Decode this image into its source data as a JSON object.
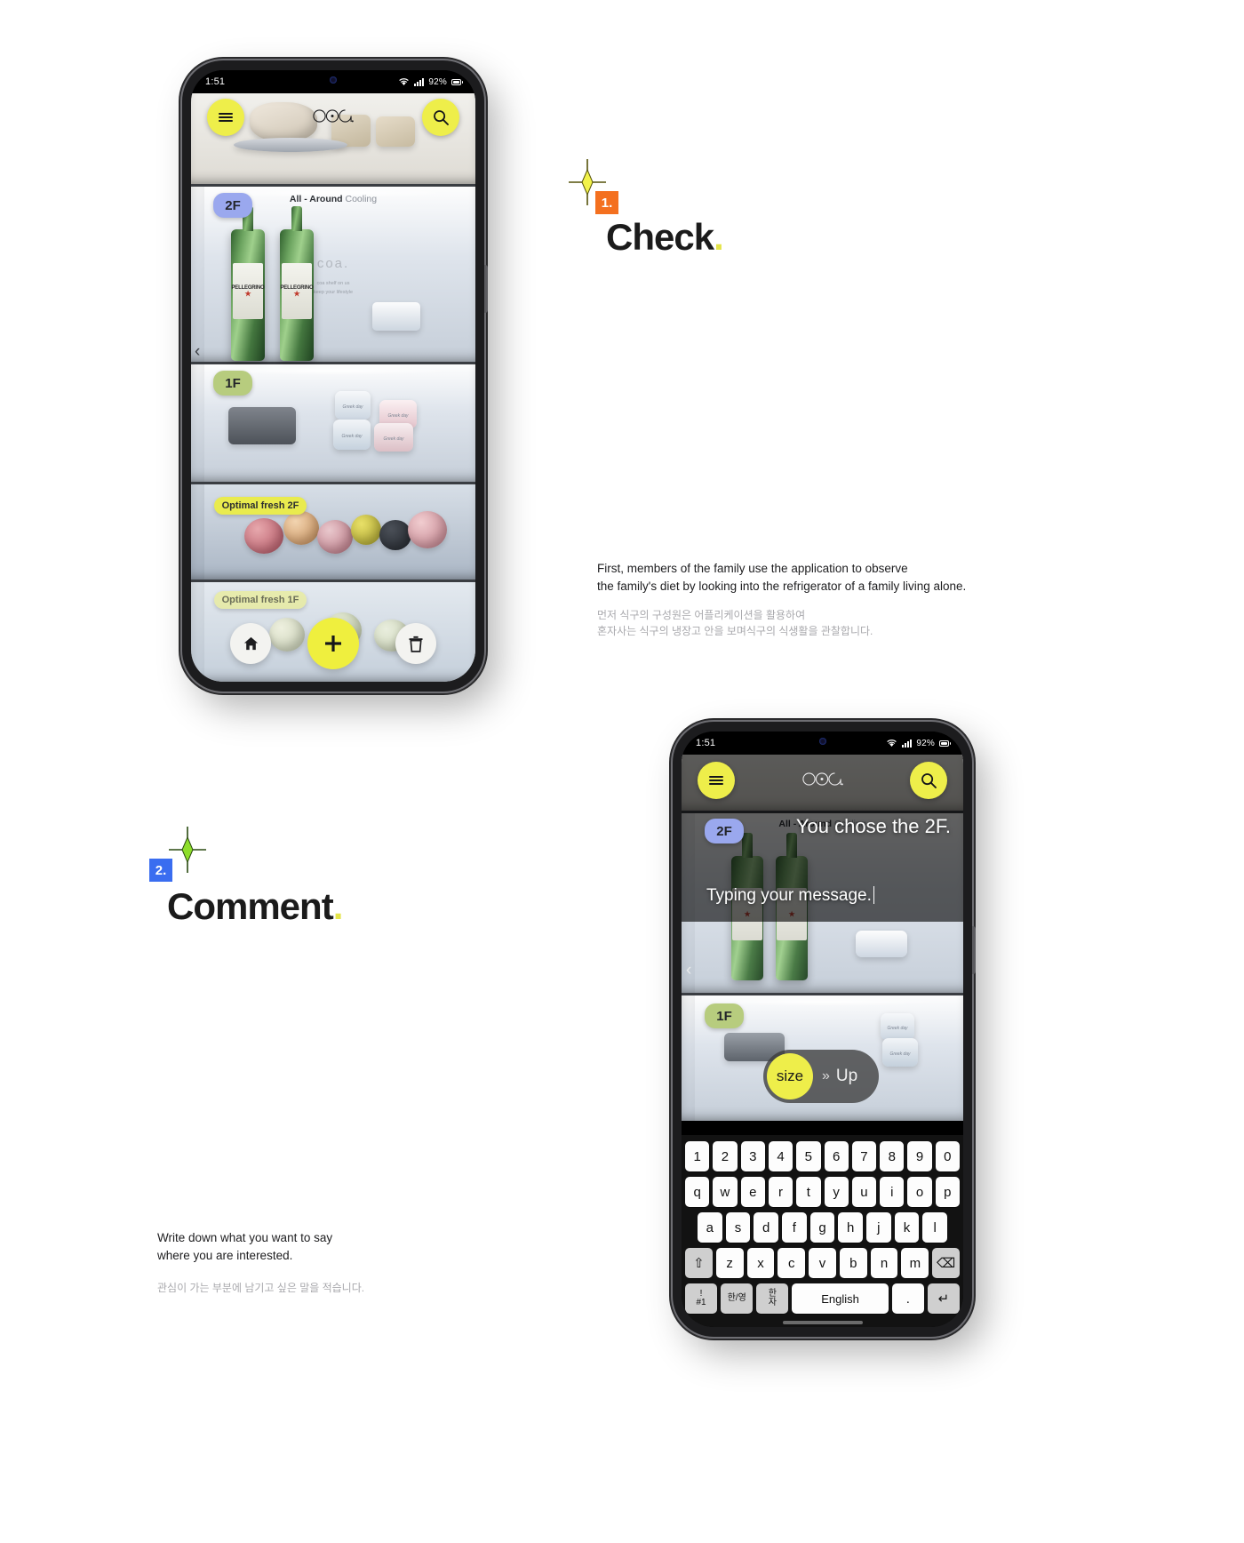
{
  "page": {
    "background": "#ffffff",
    "accent_yellow": "#eeee4a",
    "accent_orange": "#f4701f",
    "accent_blue": "#3a6df0",
    "floor2_color": "#9aa8ee",
    "floor1_color": "#b7cc7e"
  },
  "steps": [
    {
      "number": "1.",
      "title": "Check",
      "title_dot": ".",
      "badge_color": "#f4701f",
      "sparkle_color": "#f2f24a",
      "paragraph_en": "First, members of the family use the application to observe\nthe family's diet by looking into the refrigerator of a family living alone.",
      "paragraph_ko": "먼저 식구의 구성원은 어플리케이션을 활용하여\n혼자사는 식구의 냉장고 안을 보며식구의 식생활을 관찰합니다."
    },
    {
      "number": "2.",
      "title": "Comment",
      "title_dot": ".",
      "badge_color": "#3a6df0",
      "sparkle_color": "#8ede2a",
      "paragraph_en": "Write down what you want to say\nwhere you are interested.",
      "paragraph_ko": "관심이 가는 부분에 남기고 싶은 말을 적습니다."
    }
  ],
  "phone1": {
    "statusbar": {
      "time": "1:51",
      "battery_percent": "92%",
      "wifi_icon": "wifi-icon",
      "signal_icon": "signal-icon",
      "battery_icon": "battery-icon"
    },
    "topbar": {
      "menu_icon": "hamburger-menu-icon",
      "logo": "coa.",
      "search_icon": "search-icon"
    },
    "cooling_label_bold": "All - Around",
    "cooling_label_light": "Cooling",
    "watermark": "coa.",
    "watermark_sub_1": "coa shelf on us",
    "watermark_sub_2": "keep your lifestyle",
    "floors": [
      {
        "label": "2F"
      },
      {
        "label": "1F"
      }
    ],
    "drawers": [
      {
        "label": "Optimal fresh 2F",
        "style": "solid"
      },
      {
        "label": "Optimal fresh 1F",
        "style": "ghost"
      }
    ],
    "prev_arrow": "‹",
    "bottles": [
      {
        "brand": "PELLEGRINO"
      },
      {
        "brand": "PELLEGRINO"
      }
    ],
    "tubs": [
      {
        "label": "Greek day"
      },
      {
        "label": "Greek day"
      },
      {
        "label": "Greek day"
      },
      {
        "label": "Greek day"
      }
    ],
    "bottom_nav": [
      {
        "icon": "home-icon",
        "name": "home-button"
      },
      {
        "icon": "plus-icon",
        "name": "add-button"
      },
      {
        "icon": "trash-icon",
        "name": "delete-button"
      }
    ]
  },
  "phone2": {
    "statusbar": {
      "time": "1:51",
      "battery_percent": "92%",
      "wifi_icon": "wifi-icon",
      "signal_icon": "signal-icon",
      "battery_icon": "battery-icon"
    },
    "topbar": {
      "menu_icon": "hamburger-menu-icon",
      "logo": "coa.",
      "search_icon": "search-icon"
    },
    "headline": "You chose the 2F.",
    "message_placeholder": "Typing your message.",
    "cooling_label_bold": "All - Around",
    "cooling_label_light": "Cooling",
    "floors": [
      {
        "label": "2F"
      },
      {
        "label": "1F"
      }
    ],
    "size_control": {
      "chip": "size",
      "arrows": "»",
      "value": "Up"
    },
    "prev_arrow": "‹",
    "keyboard": {
      "row1": [
        "1",
        "2",
        "3",
        "4",
        "5",
        "6",
        "7",
        "8",
        "9",
        "0"
      ],
      "row2": [
        "q",
        "w",
        "e",
        "r",
        "t",
        "y",
        "u",
        "i",
        "o",
        "p"
      ],
      "row3": [
        "a",
        "s",
        "d",
        "f",
        "g",
        "h",
        "j",
        "k",
        "l"
      ],
      "row4": [
        "z",
        "x",
        "c",
        "v",
        "b",
        "n",
        "m"
      ],
      "shift_key": "⇧",
      "backspace_key": "⌫",
      "symbols_key_top": "!",
      "symbols_key_bottom": "#1",
      "lang_key": "한/영",
      "hanja_key_top": "한",
      "hanja_key_bottom": "자",
      "space_key": "English",
      "period_key": ".",
      "enter_key": "↵"
    }
  }
}
